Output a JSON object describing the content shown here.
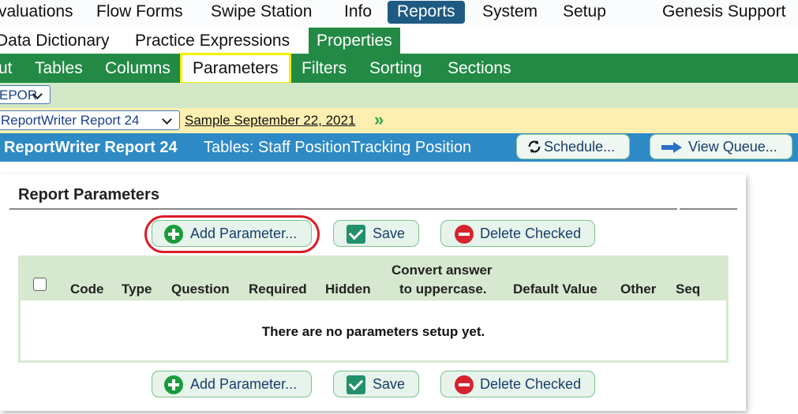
{
  "top_nav": {
    "items": [
      "valuations",
      "Flow Forms",
      "Swipe Station",
      "Info",
      "Reports",
      "System",
      "Setup"
    ],
    "right": "Genesis Support"
  },
  "sub_nav": {
    "items": [
      "Data Dictionary",
      "Practice Expressions",
      "Properties"
    ]
  },
  "tabs": [
    "ut",
    "Tables",
    "Columns",
    "Parameters",
    "Filters",
    "Sorting",
    "Sections"
  ],
  "category_select": {
    "value": "EPOR"
  },
  "report_select": {
    "value": "ReportWriter Report 24"
  },
  "sample_link": "Sample September 22, 2021",
  "header": {
    "report_name": "ReportWriter Report 24",
    "tables": "Tables: Staff PositionTracking Position",
    "schedule_button": "Schedule...",
    "view_queue_button": "View Queue..."
  },
  "panel": {
    "title": "Report Parameters",
    "add_button": "Add Parameter...",
    "save_button": "Save",
    "delete_button": "Delete Checked",
    "columns": {
      "code": "Code",
      "type": "Type",
      "question": "Question",
      "required": "Required",
      "hidden": "Hidden",
      "convert_line1": "Convert answer",
      "convert_line2": "to uppercase.",
      "default_value": "Default Value",
      "other": "Other",
      "seq": "Seq"
    },
    "empty_message": "There are no parameters setup yet."
  },
  "colors": {
    "reports_tab": "#1f5a83",
    "green_bar": "#238a45",
    "header_blue": "#2d8ac5",
    "highlight_yellow": "#f5f000",
    "annotation_red": "#d81e28"
  }
}
